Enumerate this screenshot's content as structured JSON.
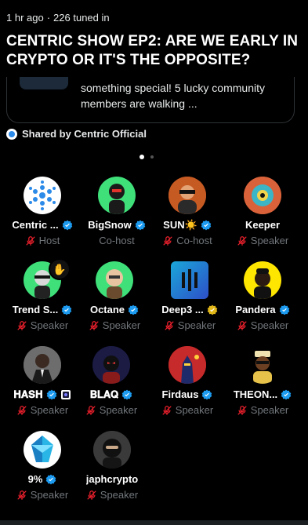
{
  "header": {
    "time_ago": "1 hr ago",
    "separator": "·",
    "tuned_in": "226 tuned in",
    "title": "CENTRIC SHOW EP2: ARE WE EARLY IN CRYPTO OR IT'S THE OPPOSITE?"
  },
  "card": {
    "description": "something special! 5 lucky community members are walking ..."
  },
  "shared_by": "Shared by Centric Official",
  "speakers": [
    {
      "name": "Centric ...",
      "role": "Host",
      "verified": "blue"
    },
    {
      "name": "BigSnow",
      "role": "Co-host",
      "verified": "blue"
    },
    {
      "name": "SUN☀️",
      "role": "Co-host",
      "verified": "blue"
    },
    {
      "name": "Keeper",
      "role": "Speaker",
      "verified": ""
    },
    {
      "name": "Trend S...",
      "role": "Speaker",
      "verified": "blue"
    },
    {
      "name": "Octane",
      "role": "Speaker",
      "verified": "blue"
    },
    {
      "name": "Deep3 ...",
      "role": "Speaker",
      "verified": "gold"
    },
    {
      "name": "Pandera",
      "role": "Speaker",
      "verified": "blue"
    },
    {
      "name": "𝐇𝐀𝐒𝐇",
      "role": "Speaker",
      "verified": "blue"
    },
    {
      "name": "𝐁𝐋𝐀𝐐",
      "role": "Speaker",
      "verified": "blue"
    },
    {
      "name": "Firdaus",
      "role": "Speaker",
      "verified": "blue"
    },
    {
      "name": "THEON...",
      "role": "Speaker",
      "verified": "blue"
    },
    {
      "name": "9%",
      "role": "Speaker",
      "verified": "blue"
    },
    {
      "name": "japhcrypto",
      "role": "Speaker",
      "verified": ""
    }
  ],
  "colors": {
    "background": "#000000",
    "verified_blue": "#1d9bf0",
    "verified_gold": "#e2b719",
    "muted_red": "#f4212e",
    "secondary_text": "#71767b"
  }
}
